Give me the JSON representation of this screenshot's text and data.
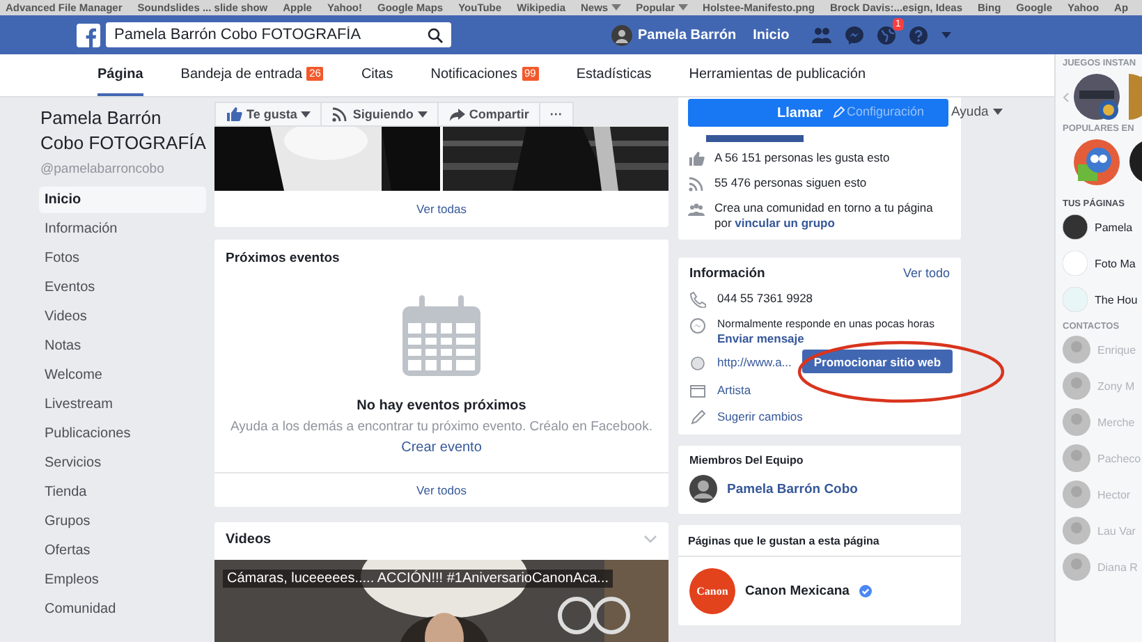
{
  "bookmarks": [
    {
      "label": "Advanced File Manager",
      "menu": false
    },
    {
      "label": "Soundslides ... slide show",
      "menu": false
    },
    {
      "label": "Apple",
      "menu": false
    },
    {
      "label": "Yahoo!",
      "menu": false
    },
    {
      "label": "Google Maps",
      "menu": false
    },
    {
      "label": "YouTube",
      "menu": false
    },
    {
      "label": "Wikipedia",
      "menu": false
    },
    {
      "label": "News",
      "menu": true
    },
    {
      "label": "Popular",
      "menu": true
    },
    {
      "label": "Holstee-Manifesto.png",
      "menu": false
    },
    {
      "label": "Brock Davis:...esign, Ideas",
      "menu": false
    },
    {
      "label": "Bing",
      "menu": false
    },
    {
      "label": "Google",
      "menu": false
    },
    {
      "label": "Yahoo",
      "menu": false
    },
    {
      "label": "Ap",
      "menu": false
    }
  ],
  "header": {
    "search_value": "Pamela Barrón Cobo FOTOGRAFÍA",
    "user_name": "Pamela Barrón",
    "home_link": "Inicio",
    "notification_count": "1"
  },
  "tabs": [
    {
      "label": "Página",
      "selected": true
    },
    {
      "label": "Bandeja de entrada",
      "badge": "26",
      "selected": false
    },
    {
      "label": "Citas",
      "selected": false
    },
    {
      "label": "Notificaciones",
      "badge": "99",
      "selected": false
    },
    {
      "label": "Estadísticas",
      "selected": false
    },
    {
      "label": "Herramientas de publicación",
      "selected": false
    }
  ],
  "page": {
    "name": "Pamela Barrón Cobo FOTOGRAFÍA",
    "handle": "@pamelabarroncobo"
  },
  "nav": [
    {
      "label": "Inicio",
      "selected": true
    },
    {
      "label": "Información",
      "selected": false
    },
    {
      "label": "Fotos",
      "selected": false
    },
    {
      "label": "Eventos",
      "selected": false
    },
    {
      "label": "Videos",
      "selected": false
    },
    {
      "label": "Notas",
      "selected": false
    },
    {
      "label": "Welcome",
      "selected": false
    },
    {
      "label": "Livestream",
      "selected": false
    },
    {
      "label": "Publicaciones",
      "selected": false
    },
    {
      "label": "Servicios",
      "selected": false
    },
    {
      "label": "Tienda",
      "selected": false
    },
    {
      "label": "Grupos",
      "selected": false
    },
    {
      "label": "Ofertas",
      "selected": false
    },
    {
      "label": "Empleos",
      "selected": false
    },
    {
      "label": "Comunidad",
      "selected": false
    }
  ],
  "actions": [
    {
      "kind": "like",
      "label": "Te gusta",
      "menu": true
    },
    {
      "kind": "follow",
      "label": "Siguiendo",
      "menu": true
    },
    {
      "kind": "share",
      "label": "Compartir",
      "menu": false
    },
    {
      "kind": "more",
      "label": "···",
      "menu": false
    }
  ],
  "photos": {
    "link": "Ver todas"
  },
  "events": {
    "title": "Próximos eventos",
    "empty_title": "No hay eventos próximos",
    "empty_text": "Ayuda a los demás a encontrar tu próximo evento. Créalo en Facebook.",
    "create_link": "Crear evento",
    "footer_link": "Ver todos"
  },
  "videos": {
    "title": "Videos",
    "caption": "Cámaras, luceeeees..... ACCIÓN!!! #1AniversarioCanonAca..."
  },
  "call_button": "Llamar",
  "settings_link": "Configuración",
  "help_menu": "Ayuda",
  "stats": [
    {
      "kind": "likes",
      "text": "A 56 151 personas les gusta esto"
    },
    {
      "kind": "followers",
      "text": "55 476 personas siguen esto"
    },
    {
      "kind": "group",
      "text": "Crea una comunidad en torno a tu página por",
      "link": "vincular un grupo"
    }
  ],
  "info": {
    "title": "Información",
    "see_all": "Ver todo",
    "items": [
      {
        "kind": "phone",
        "text": "044 55 7361 9928"
      },
      {
        "kind": "message",
        "text": "Normalmente responde en unas pocas horas",
        "link": "Enviar mensaje"
      },
      {
        "kind": "website",
        "text": "http://www.a...",
        "button": "Promocionar sitio web"
      },
      {
        "kind": "category",
        "link": "Artista"
      },
      {
        "kind": "edit",
        "link": "Sugerir cambios"
      }
    ]
  },
  "team": {
    "title": "Miembros Del Equipo",
    "member": "Pamela Barrón Cobo"
  },
  "liked_pages": {
    "title": "Páginas que le gustan a esta página",
    "pages": [
      {
        "logo_text": "Canon",
        "name": "Canon Mexicana",
        "verified": true
      }
    ]
  },
  "sidebar": {
    "games_heading": "JUEGOS INSTAN",
    "popular_heading": "POPULARES EN",
    "pages_heading": "TUS PÁGINAS",
    "pages": [
      "Pamela",
      "Foto Ma",
      "The Hou"
    ],
    "contacts_heading": "CONTACTOS",
    "contacts": [
      "Enrique",
      "Zony M",
      "Merche",
      "Pacheco",
      "Hector",
      "Lau Var",
      "Diana R"
    ]
  }
}
